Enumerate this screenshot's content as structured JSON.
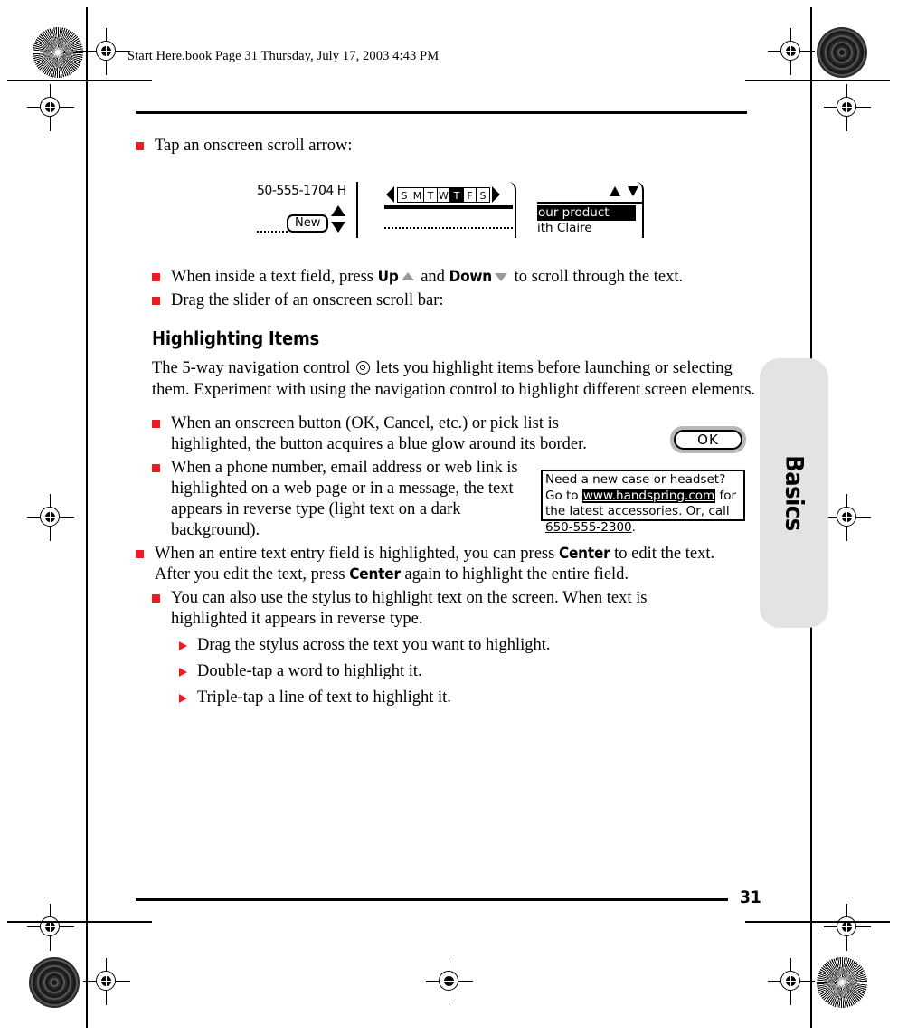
{
  "header": {
    "text": "Start Here.book  Page 31  Thursday, July 17, 2003  4:43 PM"
  },
  "colors": {
    "bullet_red": "#ED1C24",
    "arrow_grey": "#9a9a9a",
    "side_tab_grey": "#e3e3e3",
    "glow_grey": "#b8b8b8"
  },
  "bullets": {
    "tap_scroll_arrow": "Tap an onscreen scroll arrow:",
    "text_field_prefix": "When inside a text field, press ",
    "text_field_up": "Up",
    "text_field_mid": " and ",
    "text_field_down": "Down",
    "text_field_suffix": " to scroll through the text.",
    "drag_slider": "Drag the slider of an onscreen scroll bar:"
  },
  "figures": {
    "fig1": {
      "phone_text": "50-555-1704 H",
      "new_button": "New"
    },
    "fig2": {
      "days": [
        "S",
        "M",
        "T",
        "W",
        "T",
        "F",
        "S"
      ],
      "selected_index": 4
    },
    "fig3": {
      "row_highlighted": "our product",
      "row_plain": "ith Claire"
    },
    "ok_button": {
      "label": "OK"
    },
    "web_snippet": {
      "line1": "Need a new case or headset? Go to",
      "link": "www.handspring.com",
      "line2_rest": " for the latest",
      "line3_prefix": "accessories. Or, call ",
      "phone": "650-555-2300",
      "line3_suffix": "."
    }
  },
  "section": {
    "heading": "Highlighting Items",
    "intro_part1": "The 5-way navigation control ",
    "intro_part2": " lets you highlight items before launching or selecting them. Experiment with using the navigation control to highlight different screen elements."
  },
  "highlight_bullets": {
    "button_glow": "When an onscreen button (OK, Cancel, etc.) or pick list is highlighted, the button acquires a blue glow around its border.",
    "reverse_type": "When a phone number, email address or web link is highlighted on a web page or in a message, the text appears in reverse type (light text on a dark background).",
    "center_edit_p1": "When an entire text entry field is highlighted, you can press ",
    "center_edit_key1": "Center",
    "center_edit_p2": " to edit the text. After you edit the text, press ",
    "center_edit_key2": "Center",
    "center_edit_p3": " again to highlight the entire field.",
    "stylus": "You can also use the stylus to highlight text on the screen. When text is highlighted it appears in reverse type."
  },
  "sub_bullets": [
    "Drag the stylus across the text you want to highlight.",
    "Double-tap a word to highlight it.",
    "Triple-tap a line of text to highlight it."
  ],
  "side_tab": {
    "label": "Basics"
  },
  "footer": {
    "page_number": "31"
  }
}
